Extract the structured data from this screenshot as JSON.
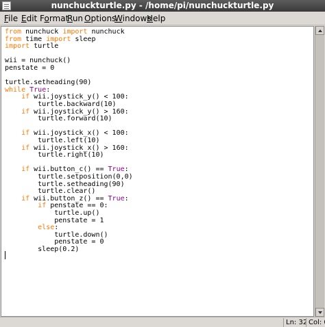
{
  "window": {
    "title": "nunchuckturtle.py - /home/pi/nunchuckturtle.py"
  },
  "menubar": {
    "items": [
      {
        "mnemonic": "F",
        "rest": "ile"
      },
      {
        "mnemonic": "E",
        "rest": "dit"
      },
      {
        "mnemonic": "",
        "pre": "F",
        "mnemonic2": "o",
        "rest": "rmat"
      },
      {
        "mnemonic": "R",
        "rest": "un"
      },
      {
        "mnemonic": "O",
        "rest": "ptions"
      },
      {
        "mnemonic": "W",
        "rest": "indows"
      },
      {
        "mnemonic": "H",
        "rest": "elp"
      }
    ]
  },
  "code": {
    "lines": [
      [
        {
          "t": "from",
          "c": "kw"
        },
        {
          "t": " nunchuck "
        },
        {
          "t": "import",
          "c": "kw"
        },
        {
          "t": " nunchuck"
        }
      ],
      [
        {
          "t": "from",
          "c": "kw"
        },
        {
          "t": " time "
        },
        {
          "t": "import",
          "c": "kw"
        },
        {
          "t": " sleep"
        }
      ],
      [
        {
          "t": "import",
          "c": "kw"
        },
        {
          "t": " turtle"
        }
      ],
      [],
      [
        {
          "t": "wii = nunchuck()"
        }
      ],
      [
        {
          "t": "penstate = 0"
        }
      ],
      [],
      [
        {
          "t": "turtle.setheading(90)"
        }
      ],
      [
        {
          "t": "while",
          "c": "kw"
        },
        {
          "t": " "
        },
        {
          "t": "True",
          "c": "bi"
        },
        {
          "t": ":"
        }
      ],
      [
        {
          "t": "    "
        },
        {
          "t": "if",
          "c": "kw"
        },
        {
          "t": " wii.joystick_y() < 100:"
        }
      ],
      [
        {
          "t": "        turtle.backward(10)"
        }
      ],
      [
        {
          "t": "    "
        },
        {
          "t": "if",
          "c": "kw"
        },
        {
          "t": " wii.joystick_y() > 160:"
        }
      ],
      [
        {
          "t": "        turtle.forward(10)"
        }
      ],
      [],
      [
        {
          "t": "    "
        },
        {
          "t": "if",
          "c": "kw"
        },
        {
          "t": " wii.joystick_x() < 100:"
        }
      ],
      [
        {
          "t": "        turtle.left(10)"
        }
      ],
      [
        {
          "t": "    "
        },
        {
          "t": "if",
          "c": "kw"
        },
        {
          "t": " wii.joystick_x() > 160:"
        }
      ],
      [
        {
          "t": "        turtle.right(10)"
        }
      ],
      [],
      [
        {
          "t": "    "
        },
        {
          "t": "if",
          "c": "kw"
        },
        {
          "t": " wii.button_c() == "
        },
        {
          "t": "True",
          "c": "bi"
        },
        {
          "t": ":"
        }
      ],
      [
        {
          "t": "        turtle.setposition(0,0)"
        }
      ],
      [
        {
          "t": "        turtle.setheading(90)"
        }
      ],
      [
        {
          "t": "        turtle.clear()"
        }
      ],
      [
        {
          "t": "    "
        },
        {
          "t": "if",
          "c": "kw"
        },
        {
          "t": " wii.button_z() == "
        },
        {
          "t": "True",
          "c": "bi"
        },
        {
          "t": ":"
        }
      ],
      [
        {
          "t": "        "
        },
        {
          "t": "if",
          "c": "kw"
        },
        {
          "t": " penstate == 0:"
        }
      ],
      [
        {
          "t": "            turtle.up()"
        }
      ],
      [
        {
          "t": "            penstate = 1"
        }
      ],
      [
        {
          "t": "        "
        },
        {
          "t": "else",
          "c": "kw"
        },
        {
          "t": ":"
        }
      ],
      [
        {
          "t": "            turtle.down()"
        }
      ],
      [
        {
          "t": "            penstate = 0"
        }
      ],
      [
        {
          "t": "        sleep(0.2)"
        }
      ]
    ]
  },
  "status": {
    "line": "Ln: 32",
    "col": "Col: 0"
  },
  "colors": {
    "keyword": "#ff7700",
    "builtin": "#900090"
  }
}
